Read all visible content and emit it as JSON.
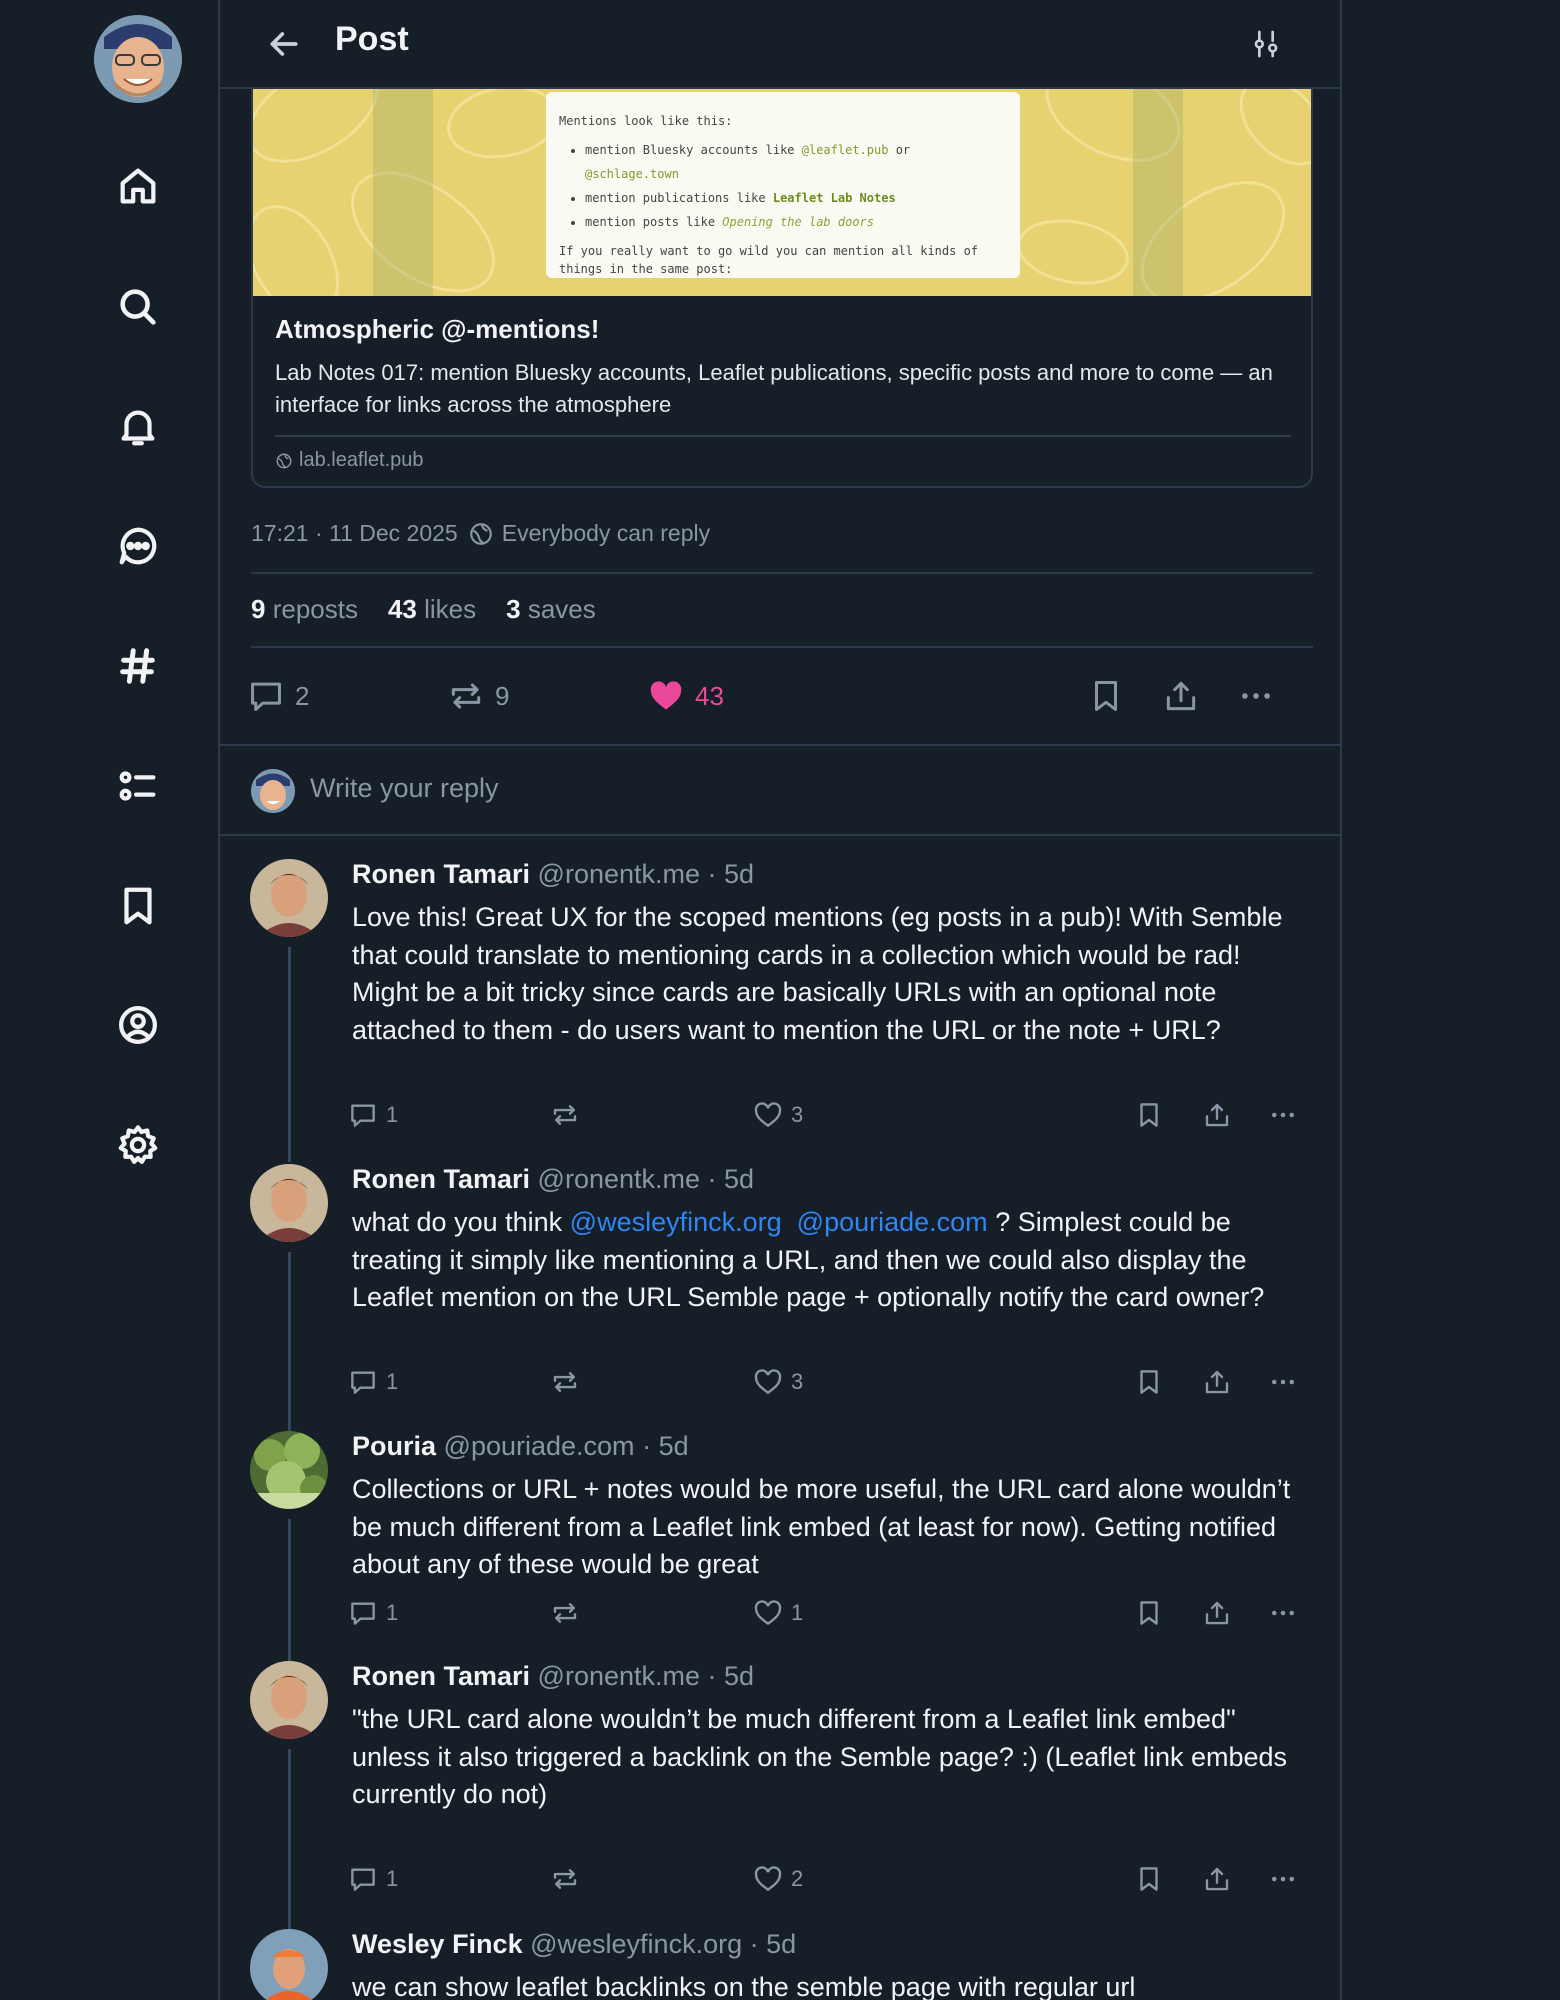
{
  "header": {
    "title": "Post"
  },
  "card": {
    "image": {
      "intro": "Mentions look like this:",
      "line1_prefix": "mention Bluesky accounts like",
      "line1_a": "@leaflet.pub",
      "line1_or": "or",
      "line1_b": "@schlage.town",
      "line2_prefix": "mention publications like",
      "line2_pub": "Leaflet Lab Notes",
      "line3_prefix": "mention posts like",
      "line3_post": "Opening the lab doors",
      "outro": "If you really want to go wild you can mention all kinds of things in the same post:"
    },
    "title": "Atmospheric @-mentions!",
    "description": "Lab Notes 017: mention Bluesky accounts, Leaflet publications, specific posts and more to come — an interface for links across the atmosphere",
    "domain": "lab.leaflet.pub"
  },
  "post_meta": {
    "timestamp": "17:21 · 11 Dec 2025",
    "reply_setting": "Everybody can reply"
  },
  "stats": {
    "reposts_count": "9",
    "reposts_label": "reposts",
    "likes_count": "43",
    "likes_label": "likes",
    "saves_count": "3",
    "saves_label": "saves"
  },
  "actions": {
    "replies": "2",
    "reposts": "9",
    "likes": "43"
  },
  "reply_composer": {
    "placeholder": "Write your reply"
  },
  "replies": [
    {
      "name": "Ronen Tamari",
      "handle": "@ronentk.me",
      "time": "· 5d",
      "text": "Love this! Great UX for the scoped mentions (eg posts in a pub)! With Semble that could translate to mentioning cards in a collection which would be rad! Might be a bit tricky since cards are basically URLs with an optional note attached to them - do users want to mention the URL or the note + URL?",
      "replies": "1",
      "likes": "3"
    },
    {
      "name": "Ronen Tamari",
      "handle": "@ronentk.me",
      "time": "· 5d",
      "text_before": "what do you think",
      "mention1": "@wesleyfinck.org",
      "mention2": "@pouriade.com",
      "text_after": "? Simplest could be treating it simply like mentioning a URL, and then we could also display the Leaflet mention on the URL Semble page + optionally notify the card owner?",
      "replies": "1",
      "likes": "3"
    },
    {
      "name": "Pouria",
      "handle": "@pouriade.com",
      "time": "· 5d",
      "text": "Collections or URL + notes would be more useful, the URL card alone wouldn’t be much different from a Leaflet link embed (at least for now). Getting notified about any of these would be great",
      "replies": "1",
      "likes": "1"
    },
    {
      "name": "Ronen Tamari",
      "handle": "@ronentk.me",
      "time": "· 5d",
      "text_line1": "\"the URL card alone wouldn’t be much different from a Leaflet link embed\"",
      "text_line2": "unless it also triggered a backlink on the Semble page? :) (Leaflet link embeds currently do not)",
      "replies": "1",
      "likes": "2"
    },
    {
      "name": "Wesley Finck",
      "handle": "@wesleyfinck.org",
      "time": "· 5d",
      "text": "we can show leaflet backlinks on the semble page with regular url"
    }
  ],
  "colors": {
    "background": "#161e27",
    "border": "#2c3a4b",
    "muted": "#8996a5",
    "like": "#ec4899",
    "mention": "#2f86f5"
  }
}
